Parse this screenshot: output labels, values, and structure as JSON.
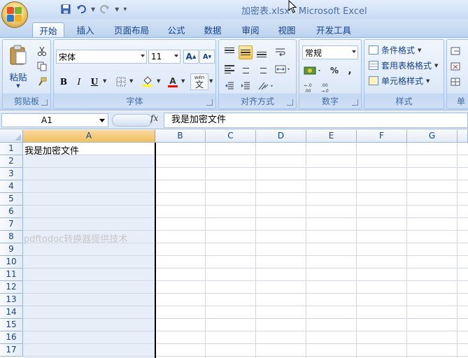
{
  "window": {
    "title": "加密表.xlsx - Microsoft Excel"
  },
  "tabs": [
    {
      "label": "开始",
      "active": true
    },
    {
      "label": "插入"
    },
    {
      "label": "页面布局"
    },
    {
      "label": "公式"
    },
    {
      "label": "数据"
    },
    {
      "label": "审阅"
    },
    {
      "label": "视图"
    },
    {
      "label": "开发工具"
    }
  ],
  "ribbon": {
    "clipboard": {
      "label": "剪贴板",
      "paste": "粘贴"
    },
    "font": {
      "label": "字体",
      "name": "宋体",
      "size": "11",
      "bold": "B",
      "italic": "I",
      "underline": "U",
      "grow": "A",
      "shrink": "A",
      "font_color": "A",
      "wen": "wén",
      "wen_char": "文"
    },
    "alignment": {
      "label": "对齐方式"
    },
    "number": {
      "label": "数字",
      "format": "常规",
      "percent": "%",
      "comma": ","
    },
    "styles": {
      "label": "样式",
      "conditional": "条件格式",
      "table": "套用表格格式",
      "cell": "单元格样式"
    },
    "cells": {
      "label": "单"
    }
  },
  "formula_bar": {
    "name_box": "A1",
    "fx": "fx",
    "content": "我是加密文件"
  },
  "sheet": {
    "columns": [
      "A",
      "B",
      "C",
      "D",
      "E",
      "F",
      "G"
    ],
    "rows": [
      "1",
      "2",
      "3",
      "4",
      "5",
      "6",
      "7",
      "8",
      "9",
      "10",
      "11",
      "12",
      "13",
      "14",
      "15",
      "16",
      "17"
    ],
    "cell_a1": "我是加密文件",
    "watermark": "pdftodoc转换器提供技术"
  },
  "colors": {
    "accent": "#15428b",
    "selected_header": "#f1c15f"
  }
}
